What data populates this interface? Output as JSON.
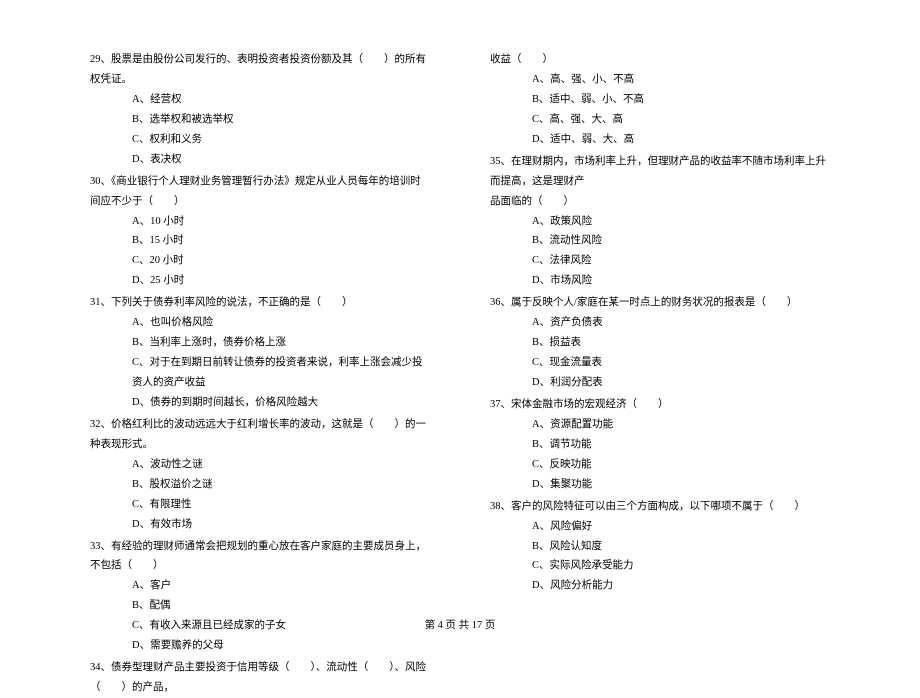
{
  "left_col": {
    "q29": {
      "text": "29、股票是由股份公司发行的、表明投资者投资份额及其（　　）的所有权凭证。",
      "a": "A、经营权",
      "b": "B、选举权和被选举权",
      "c": "C、权利和义务",
      "d": "D、表决权"
    },
    "q30": {
      "text": "30、《商业银行个人理财业务管理暂行办法》规定从业人员每年的培训时间应不少于（　　）",
      "a": "A、10 小时",
      "b": "B、15 小时",
      "c": "C、20 小时",
      "d": "D、25 小时"
    },
    "q31": {
      "text": "31、下列关于债券利率风险的说法，不正确的是（　　）",
      "a": "A、也叫价格风险",
      "b": "B、当利率上涨时，债券价格上涨",
      "c": "C、对于在到期日前转让债券的投资者来说，利率上涨会减少投资人的资产收益",
      "d": "D、债券的到期时间越长，价格风险越大"
    },
    "q32": {
      "text": "32、价格红利比的波动远远大于红利增长率的波动，这就是（　　）的一种表现形式。",
      "a": "A、波动性之谜",
      "b": "B、股权溢价之谜",
      "c": "C、有限理性",
      "d": "D、有效市场"
    },
    "q33": {
      "text": "33、有经验的理财师通常会把规划的重心放在客户家庭的主要成员身上，不包括（　　）",
      "a": "A、客户",
      "b": "B、配偶",
      "c": "C、有收入来源且已经成家的子女",
      "d": "D、需要赡养的父母"
    },
    "q34": {
      "text": "34、债券型理财产品主要投资于信用等级（　　）、流动性（　　）、风险（　　）的产品，"
    }
  },
  "right_col": {
    "q34_cont": {
      "text": "收益（　　）",
      "a": "A、高、强、小、不高",
      "b": "B、适中、弱、小、不高",
      "c": "C、高、强、大、高",
      "d": "D、适中、弱、大、高"
    },
    "q35": {
      "text": "35、在理财期内，市场利率上升，但理财产品的收益率不随市场利率上升而提高，这是理财产",
      "text2": "品面临的（　　）",
      "a": "A、政策风险",
      "b": "B、流动性风险",
      "c": "C、法律风险",
      "d": "D、市场风险"
    },
    "q36": {
      "text": "36、属于反映个人/家庭在某一时点上的财务状况的报表是（　　）",
      "a": "A、资产负债表",
      "b": "B、损益表",
      "c": "C、现金流量表",
      "d": "D、利润分配表"
    },
    "q37": {
      "text": "37、宋体金融市场的宏观经济（　　）",
      "a": "A、资源配置功能",
      "b": "B、调节功能",
      "c": "C、反映功能",
      "d": "D、集聚功能"
    },
    "q38": {
      "text": "38、客户的风险特征可以由三个方面构成，以下哪项不属于（　　）",
      "a": "A、风险偏好",
      "b": "B、风险认知度",
      "c": "C、实际风险承受能力",
      "d": "D、风险分析能力"
    }
  },
  "footer": "第 4 页 共 17 页"
}
